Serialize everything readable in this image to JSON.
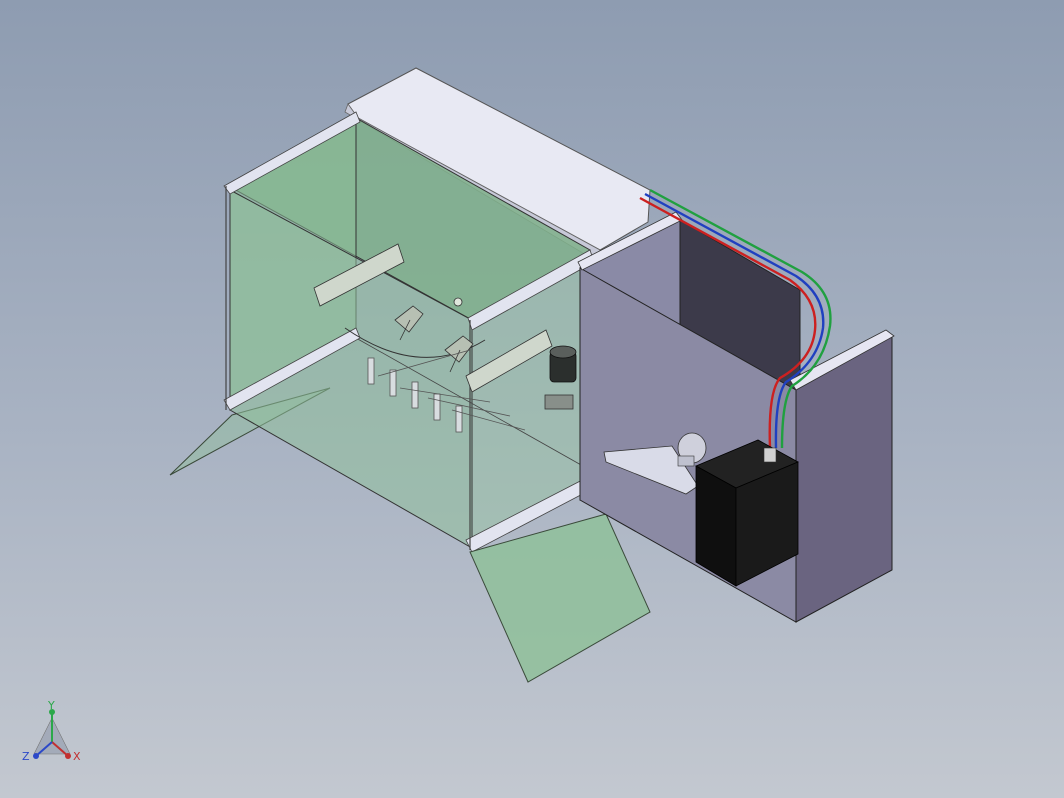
{
  "triad": {
    "x_label": "X",
    "y_label": "Y",
    "z_label": "Z"
  },
  "colors": {
    "background_top": "#8e9cb1",
    "background_bottom": "#c3c8d0",
    "glass": "#7fb08b",
    "frame": "#dde0ee",
    "housing": "#6f6d85",
    "battery": "#111111",
    "wire_red": "#cc2020",
    "wire_blue": "#2040c0",
    "wire_green": "#20a040"
  }
}
